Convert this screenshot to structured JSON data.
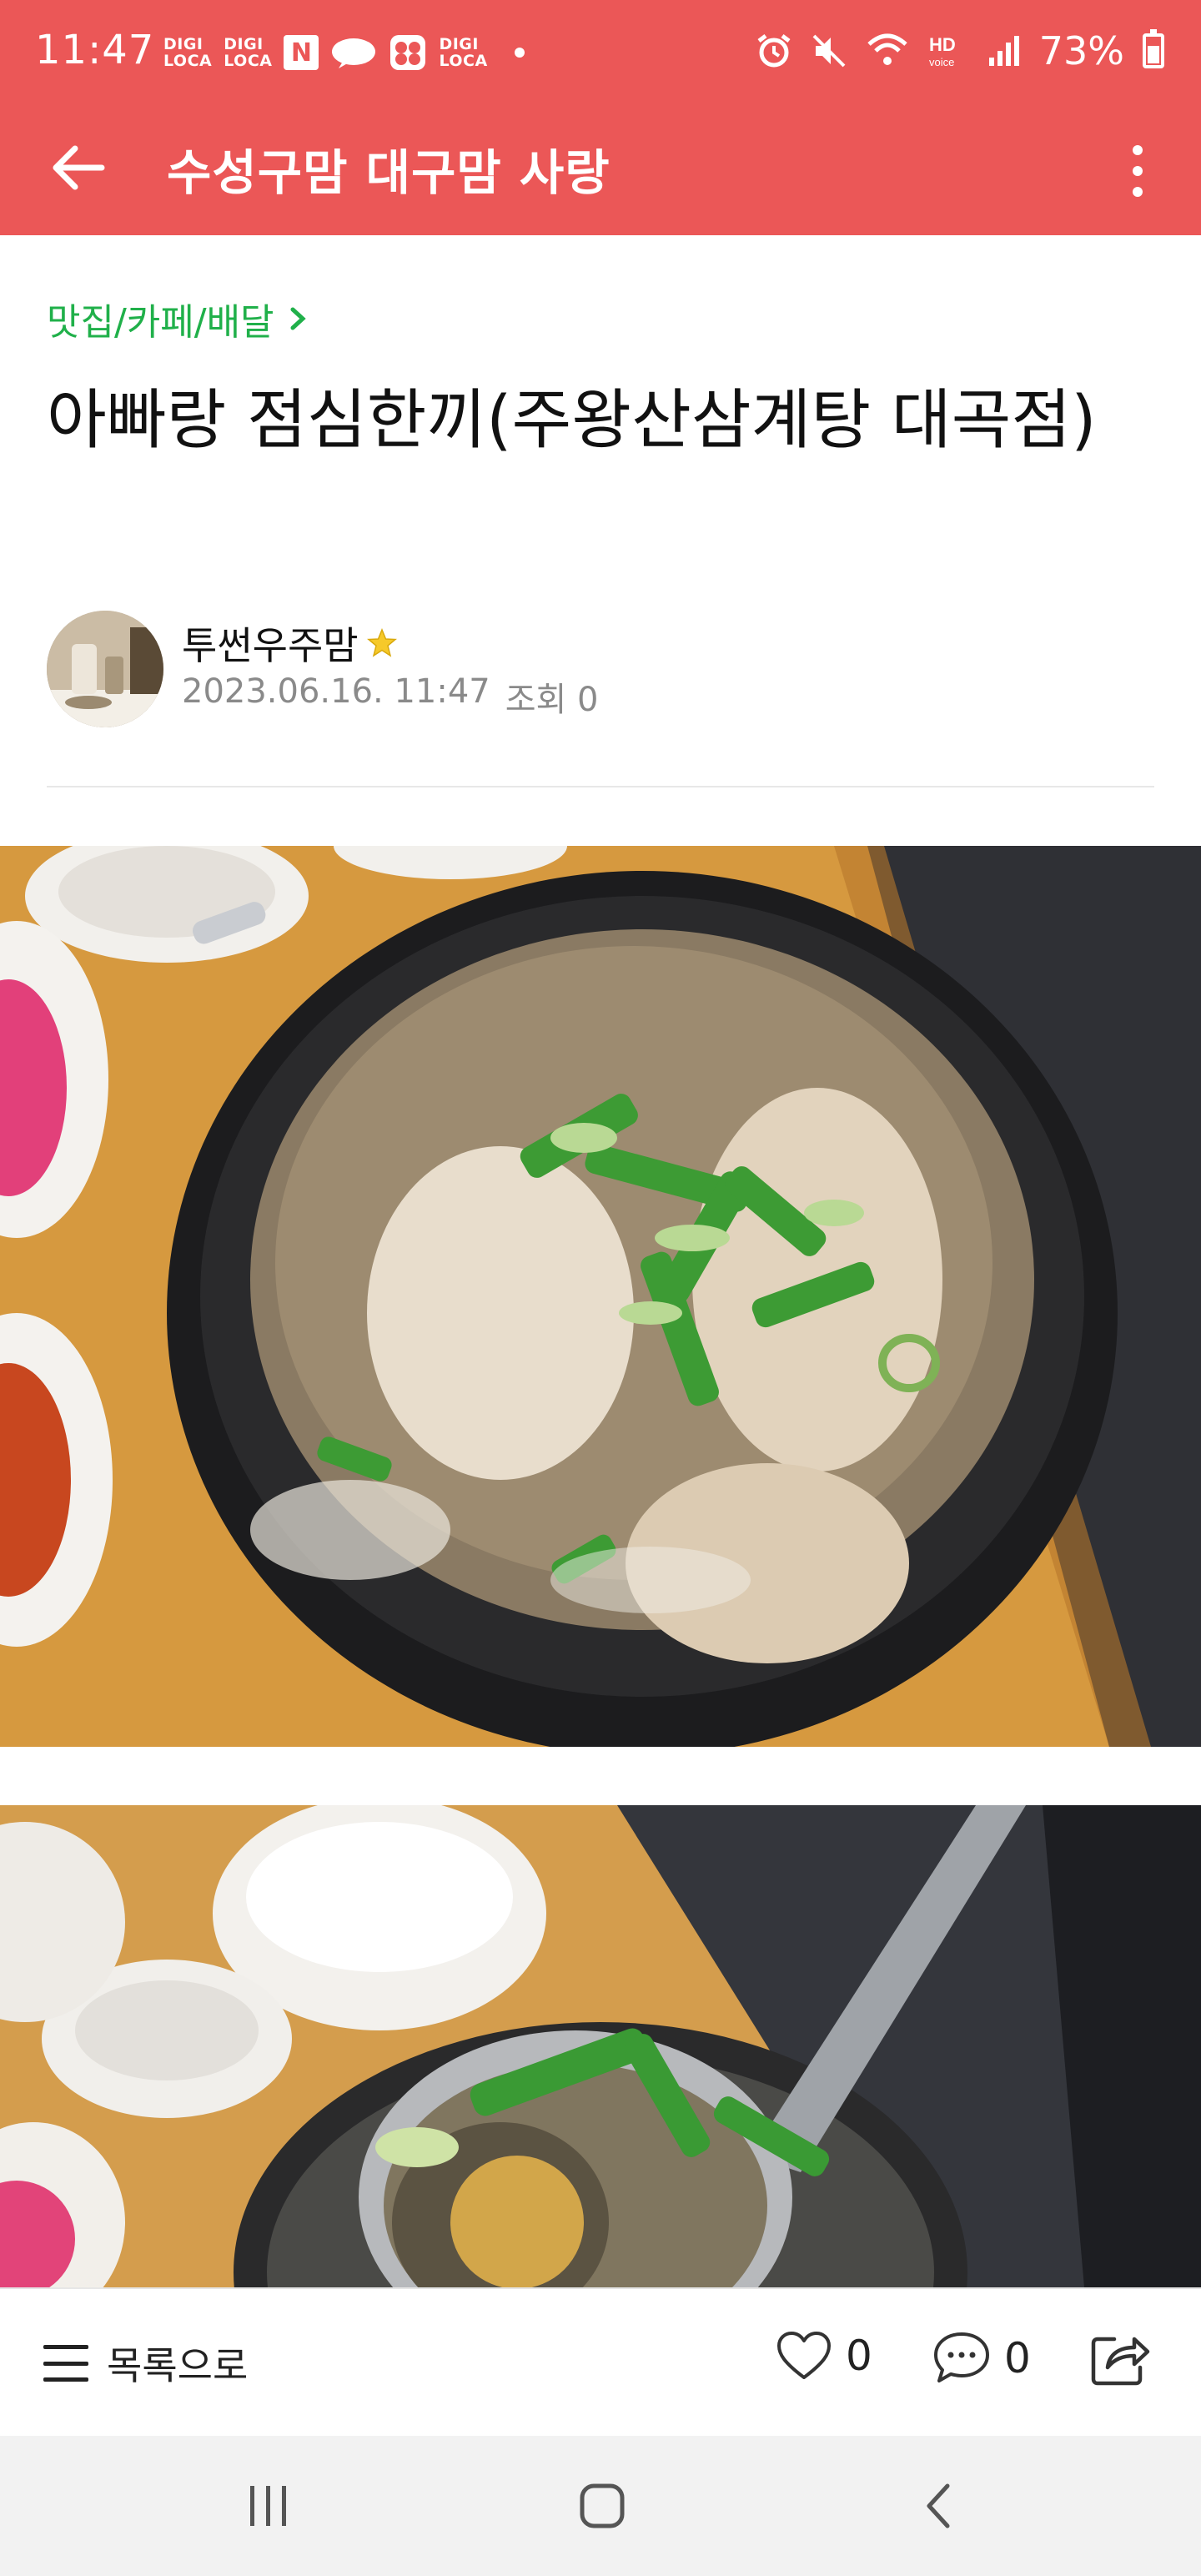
{
  "status_bar": {
    "time": "11:47",
    "digi_top": "DIGI",
    "digi_bottom": "LOCA",
    "n_icon": "N",
    "battery": "73%",
    "icons": [
      "digi-loca-icon",
      "naver-icon",
      "cloud-icon",
      "app-icon",
      "alarm-icon",
      "mute-icon",
      "wifi-icon",
      "hd-voice-icon",
      "signal-icon",
      "battery-icon"
    ]
  },
  "app_bar": {
    "title": "수성구맘 대구맘 사랑",
    "background": "#eb5757"
  },
  "article": {
    "category": "맛집/카페/배달",
    "title": "아빠랑 점심한끼(주왕산삼계탕 대곡점)",
    "author": "투썬우주맘",
    "date": "2023.06.16. 11:47",
    "views": "조회 0",
    "category_color": "#20b04a"
  },
  "bottom_bar": {
    "list_label": "목록으로",
    "like_count": "0",
    "comment_count": "0"
  }
}
